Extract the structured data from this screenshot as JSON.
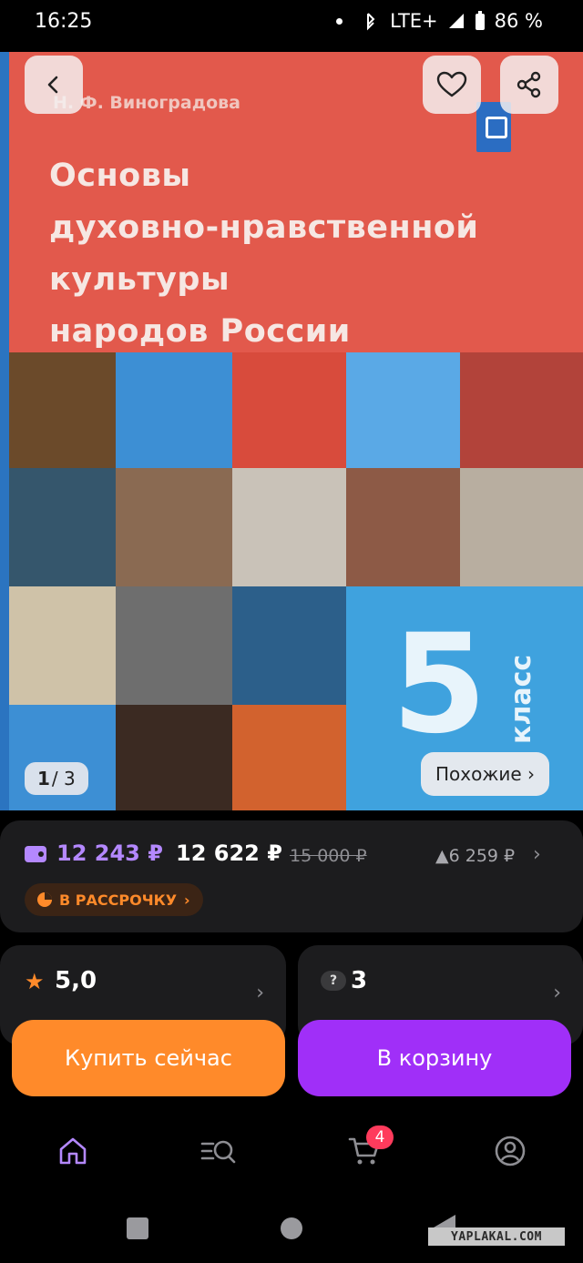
{
  "status_bar": {
    "time": "16:25",
    "network": "LTE+",
    "battery": "86 %"
  },
  "gallery": {
    "cover": {
      "author": "Н. Ф. Виноградова",
      "title_lines": [
        "Основы",
        "духовно-нравственной",
        "культуры",
        "народов России"
      ],
      "grade_number": "5",
      "grade_label": "класс"
    },
    "counter_current": "1",
    "counter_total": "/ 3",
    "similar_label": "Похожие ›"
  },
  "price": {
    "wallet_price": "12 243 ₽",
    "main_price": "12 622 ₽",
    "old_price": "15 000 ₽",
    "diff": "▲6 259 ₽",
    "installment_label": "В РАССРОЧКУ"
  },
  "rating": {
    "value": "5,0"
  },
  "questions": {
    "count": "3",
    "icon_glyph": "?"
  },
  "actions": {
    "buy_now": "Купить сейчас",
    "add_to_cart": "В корзину"
  },
  "bottom_nav": {
    "cart_badge": "4",
    "items": [
      "home-icon",
      "catalog-search-icon",
      "cart-icon",
      "profile-icon"
    ]
  },
  "watermark": "YAPLAKAL.COM",
  "colors": {
    "accent_purple": "#a02ff8",
    "accent_orange": "#ff8a2a",
    "price_purple": "#b488ff",
    "cover_red": "#e2594c"
  }
}
